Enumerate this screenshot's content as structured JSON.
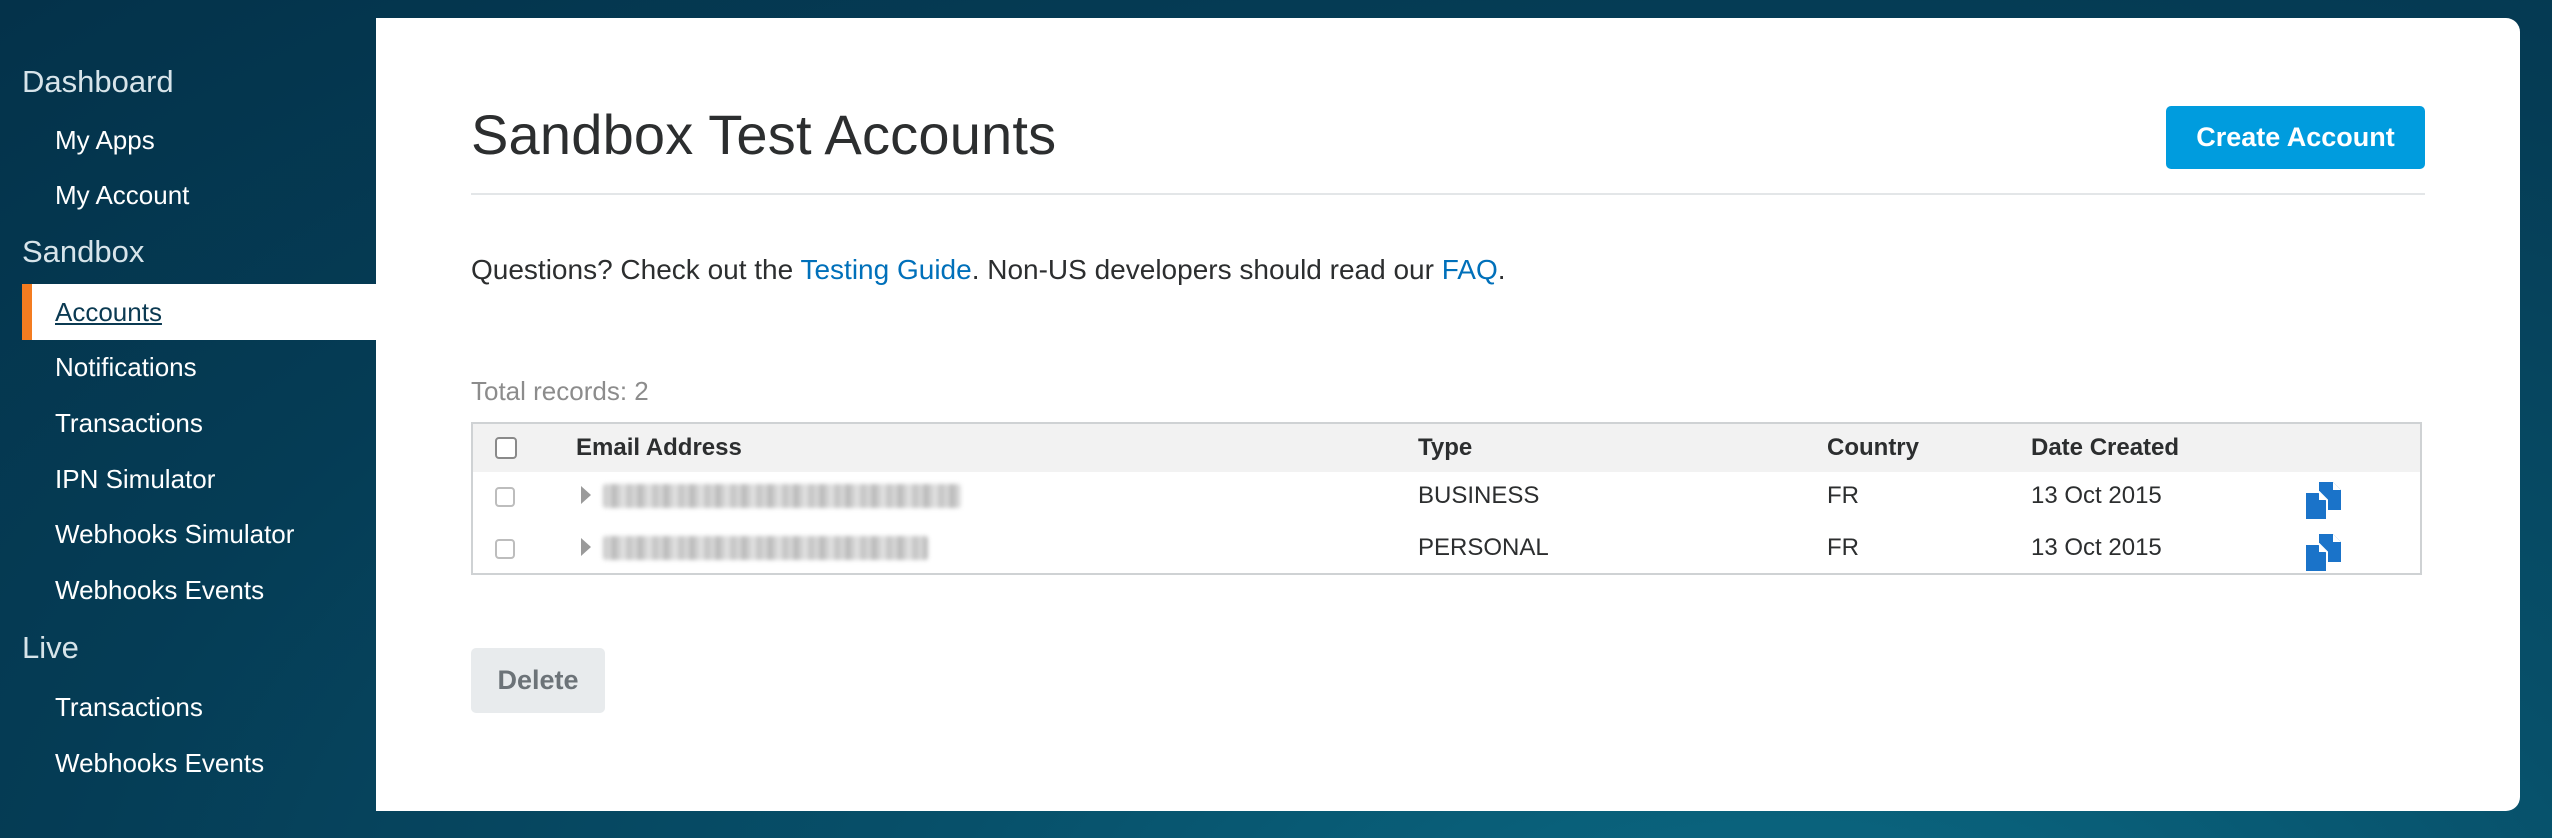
{
  "sidebar": {
    "sections": [
      {
        "title": "Dashboard",
        "items": [
          "My Apps",
          "My Account"
        ]
      },
      {
        "title": "Sandbox",
        "items": [
          "Accounts",
          "Notifications",
          "Transactions",
          "IPN Simulator",
          "Webhooks Simulator",
          "Webhooks Events"
        ]
      },
      {
        "title": "Live",
        "items": [
          "Transactions",
          "Webhooks Events"
        ]
      }
    ],
    "active_item": "Accounts"
  },
  "page": {
    "title": "Sandbox Test Accounts",
    "create_button": "Create Account",
    "intro_prefix": "Questions? Check out the ",
    "intro_link1": "Testing Guide",
    "intro_middle": ". Non-US developers should read our ",
    "intro_link2": "FAQ",
    "intro_suffix": ".",
    "total_records": "Total records: 2",
    "delete_button": "Delete"
  },
  "table": {
    "columns": [
      "Email Address",
      "Type",
      "Country",
      "Date Created"
    ],
    "rows": [
      {
        "email": "",
        "type": "BUSINESS",
        "country": "FR",
        "date": "13 Oct 2015"
      },
      {
        "email": "",
        "type": "PERSONAL",
        "country": "FR",
        "date": "13 Oct 2015"
      }
    ]
  },
  "colors": {
    "accent": "#009cde",
    "link": "#0070ba",
    "active_marker": "#f47c20",
    "icon": "#1a73c9"
  },
  "icons": {
    "row_action": "copy-documents-icon",
    "row_expand": "triangle-right-icon"
  }
}
